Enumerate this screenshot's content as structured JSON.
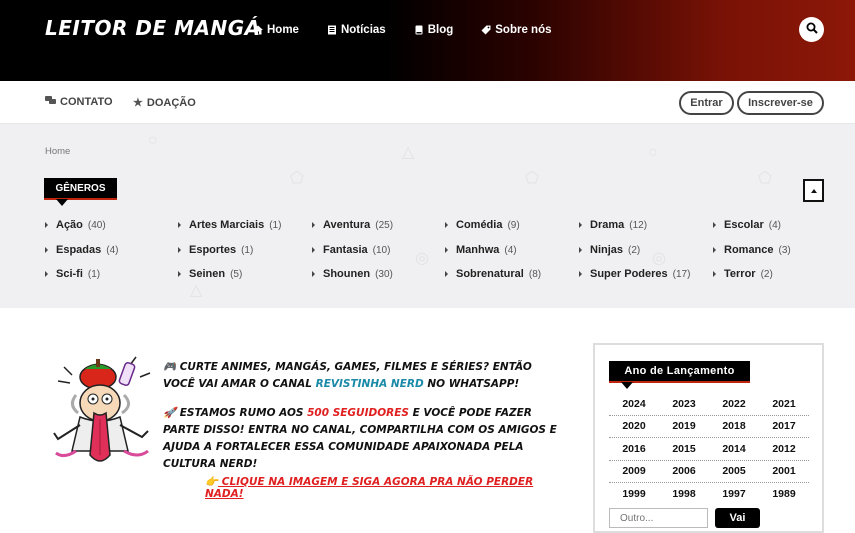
{
  "header": {
    "logo": "LEITOR DE MANGÁ",
    "nav": [
      {
        "label": "Home",
        "icon": "home-icon"
      },
      {
        "label": "Notícias",
        "icon": "newspaper-icon"
      },
      {
        "label": "Blog",
        "icon": "book-icon"
      },
      {
        "label": "Sobre nós",
        "icon": "tag-icon"
      }
    ],
    "search_icon": "search-icon"
  },
  "subbar": {
    "contato": "CONTATO",
    "doacao": "DOAÇÃO",
    "entrar": "Entrar",
    "inscrever": "Inscrever-se"
  },
  "breadcrumb": "Home",
  "genres": {
    "title": "GÊNEROS",
    "items": [
      {
        "name": "Ação",
        "count": "(40)"
      },
      {
        "name": "Artes Marciais",
        "count": "(1)"
      },
      {
        "name": "Aventura",
        "count": "(25)"
      },
      {
        "name": "Comédia",
        "count": "(9)"
      },
      {
        "name": "Drama",
        "count": "(12)"
      },
      {
        "name": "Escolar",
        "count": "(4)"
      },
      {
        "name": "Espadas",
        "count": "(4)"
      },
      {
        "name": "Esportes",
        "count": "(1)"
      },
      {
        "name": "Fantasia",
        "count": "(10)"
      },
      {
        "name": "Manhwa",
        "count": "(4)"
      },
      {
        "name": "Ninjas",
        "count": "(2)"
      },
      {
        "name": "Romance",
        "count": "(3)"
      },
      {
        "name": "Sci-fi",
        "count": "(1)"
      },
      {
        "name": "Seinen",
        "count": "(5)"
      },
      {
        "name": "Shounen",
        "count": "(30)"
      },
      {
        "name": "Sobrenatural",
        "count": "(8)"
      },
      {
        "name": "Super Poderes",
        "count": "(17)"
      },
      {
        "name": "Terror",
        "count": "(2)"
      }
    ]
  },
  "promo": {
    "line1a": "🎮 CURTE ANIMES, MANGÁS, GAMES, FILMES E SÉRIES? ENTÃO VOCÊ VAI AMAR O CANAL ",
    "line1_link": "REVISTINHA NERD",
    "line1b": " NO WHATSAPP!",
    "line2a": "🚀 ESTAMOS RUMO AOS ",
    "line2_highlight": "500 SEGUIDORES",
    "line2b": " E VOCÊ PODE FAZER PARTE DISSO! ENTRA NO CANAL, COMPARTILHA COM OS AMIGOS E AJUDA A FORTALECER ESSA COMUNIDADE APAIXONADA PELA CULTURA NERD!",
    "cta_icon": "👉",
    "cta": "CLIQUE NA IMAGEM E SIGA AGORA PRA NÃO PERDER NADA!"
  },
  "years": {
    "title": "Ano de Lançamento",
    "rows": [
      [
        "2024",
        "2023",
        "2022",
        "2021"
      ],
      [
        "2020",
        "2019",
        "2018",
        "2017"
      ],
      [
        "2016",
        "2015",
        "2014",
        "2012"
      ],
      [
        "2009",
        "2006",
        "2005",
        "2001"
      ],
      [
        "1999",
        "1998",
        "1997",
        "1989"
      ]
    ],
    "input_placeholder": "Outro...",
    "go": "Vai"
  }
}
